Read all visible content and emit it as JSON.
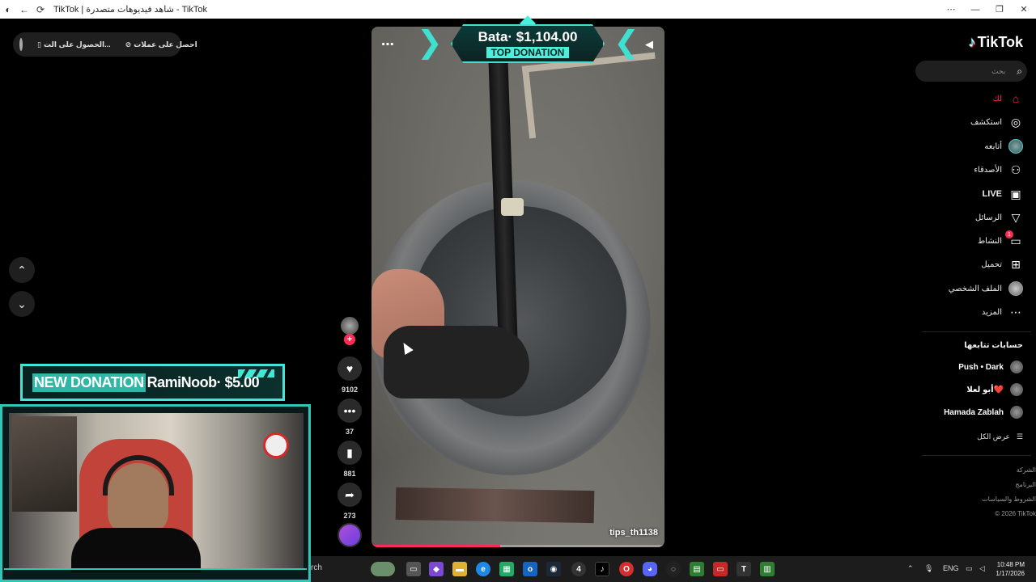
{
  "window": {
    "title": "TikTok | شاهد فيديوهات متصدرة - TikTok",
    "controls": [
      "⋯",
      "—",
      "❐",
      "✕"
    ]
  },
  "top_pill": {
    "item1": "احصل على عملات",
    "item2": "الحصول على الت..."
  },
  "top_donation": {
    "amount": "Bata· $1,104.00",
    "label": "TOP DONATION"
  },
  "video": {
    "username": "tips_th1138",
    "progress": 0.44
  },
  "actions": {
    "likes": "9102",
    "comments": "37",
    "saves": "881",
    "shares": "273"
  },
  "new_donation": {
    "label": "NEW DONATION",
    "text": "RamiNoob· $5.00"
  },
  "sidebar": {
    "logo": "TikTok",
    "search_placeholder": "بحث",
    "items": [
      {
        "label": "لك",
        "icon": "home-icon"
      },
      {
        "label": "استكشف",
        "icon": "compass-icon"
      },
      {
        "label": "أتابعه",
        "icon": "avatar-icon"
      },
      {
        "label": "الأصدقاء",
        "icon": "friends-icon"
      },
      {
        "label": "LIVE",
        "icon": "live-icon"
      },
      {
        "label": "الرسائل",
        "icon": "send-icon"
      },
      {
        "label": "النشاط",
        "icon": "activity-icon",
        "badge": "1"
      },
      {
        "label": "تحميل",
        "icon": "upload-icon"
      },
      {
        "label": "الملف الشخصي",
        "icon": "profile-icon"
      },
      {
        "label": "المزيد",
        "icon": "more-icon"
      }
    ],
    "following_heading": "حسابات تتابعها",
    "accounts": [
      {
        "name": "Push • Dark"
      },
      {
        "name": "أبو لعلا❤️"
      },
      {
        "name": "Hamada Zablah"
      }
    ],
    "see_all": "عرض الكل",
    "footer": [
      "الشركة",
      "البرنامج",
      "الشروط والسياسات",
      "© 2026 TikTok"
    ]
  },
  "taskbar": {
    "search_text": "rch",
    "lang": "ENG",
    "time": "10:48 PM",
    "date": "1/17/2026"
  },
  "colors": {
    "accent": "#fe2c55",
    "donation_teal": "#43e6d4"
  }
}
